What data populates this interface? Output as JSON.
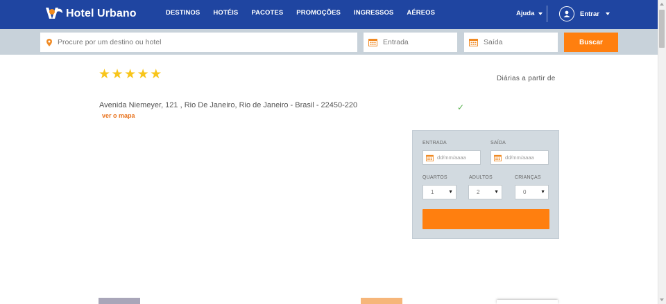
{
  "header": {
    "brand": "Hotel Urbano",
    "nav": [
      "DESTINOS",
      "HOTÉIS",
      "PACOTES",
      "PROMOÇÕES",
      "INGRESSOS",
      "AÉREOS"
    ],
    "help_label": "Ajuda",
    "login_label": "Entrar",
    "brand_color": "#1f45a1"
  },
  "search": {
    "destination_placeholder": "Procure por um destino ou hotel",
    "checkin_placeholder": "Entrada",
    "checkout_placeholder": "Saída",
    "button_label": "Buscar",
    "accent_color": "#ff7f0f"
  },
  "hotel": {
    "star_rating": 5,
    "stars": [
      "★",
      "★",
      "★",
      "★",
      "★"
    ],
    "daily_from_label": "Diárias a partir de",
    "address": "Avenida Niemeyer, 121 , Rio De Janeiro, Rio de Janeiro - Brasil - 22450-220",
    "map_link": "ver o mapa",
    "check_icon": "✓"
  },
  "booking": {
    "checkin_label": "ENTRADA",
    "checkout_label": "SAÍDA",
    "date_placeholder": "dd/mm/aaaa",
    "rooms_label": "QUARTOS",
    "adults_label": "ADULTOS",
    "children_label": "CRIANÇAS",
    "rooms_value": "1",
    "adults_value": "2",
    "children_value": "0",
    "select_arrow": "▼"
  }
}
